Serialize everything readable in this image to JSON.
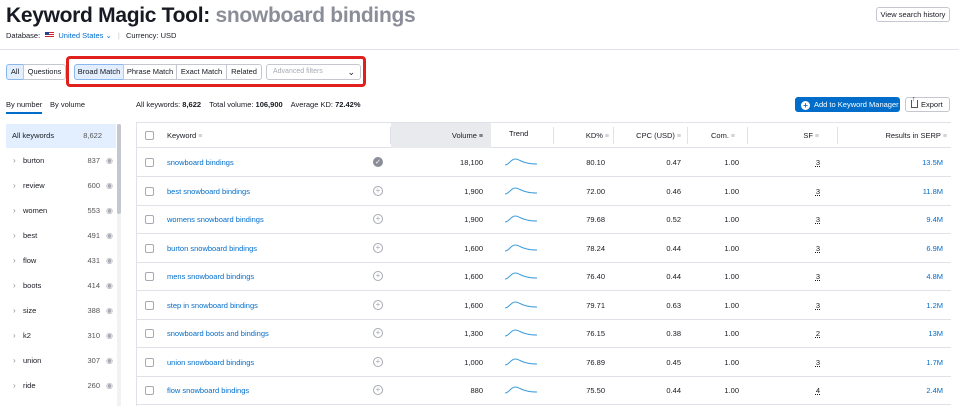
{
  "header": {
    "title_prefix": "Keyword Magic Tool:",
    "title_query": "snowboard bindings",
    "database_label": "Database:",
    "database_value": "United States",
    "currency_label": "Currency:",
    "currency_value": "USD",
    "history_button": "View search history"
  },
  "filters": {
    "all": "All",
    "questions": "Questions",
    "broad_match": "Broad Match",
    "phrase_match": "Phrase Match",
    "exact_match": "Exact Match",
    "related": "Related",
    "advanced_placeholder": "Advanced filters"
  },
  "side_tabs": {
    "by_number": "By number",
    "by_volume": "By volume"
  },
  "summary": {
    "all_keywords_label": "All keywords:",
    "all_keywords_value": "8,622",
    "total_volume_label": "Total volume:",
    "total_volume_value": "106,900",
    "avg_kd_label": "Average KD:",
    "avg_kd_value": "72.42%"
  },
  "actions": {
    "add_to_manager": "Add to Keyword Manager",
    "export": "Export"
  },
  "sidebar": {
    "items": [
      {
        "label": "All keywords",
        "count": "8,622"
      },
      {
        "label": "burton",
        "count": "837"
      },
      {
        "label": "review",
        "count": "600"
      },
      {
        "label": "women",
        "count": "553"
      },
      {
        "label": "best",
        "count": "491"
      },
      {
        "label": "flow",
        "count": "431"
      },
      {
        "label": "boots",
        "count": "414"
      },
      {
        "label": "size",
        "count": "388"
      },
      {
        "label": "k2",
        "count": "310"
      },
      {
        "label": "union",
        "count": "307"
      },
      {
        "label": "ride",
        "count": "260"
      }
    ]
  },
  "table": {
    "columns": {
      "keyword": "Keyword",
      "volume": "Volume",
      "trend": "Trend",
      "kd": "KD%",
      "cpc": "CPC (USD)",
      "com": "Com.",
      "sf": "SF",
      "results": "Results in SERP"
    },
    "rows": [
      {
        "keyword": "snowboard bindings",
        "added": true,
        "volume": "18,100",
        "kd": "80.10",
        "cpc": "0.47",
        "com": "1.00",
        "sf": "3",
        "results": "13.5M"
      },
      {
        "keyword": "best snowboard bindings",
        "added": false,
        "volume": "1,900",
        "kd": "72.00",
        "cpc": "0.46",
        "com": "1.00",
        "sf": "3",
        "results": "11.8M"
      },
      {
        "keyword": "womens snowboard bindings",
        "added": false,
        "volume": "1,900",
        "kd": "79.68",
        "cpc": "0.52",
        "com": "1.00",
        "sf": "3",
        "results": "9.4M"
      },
      {
        "keyword": "burton snowboard bindings",
        "added": false,
        "volume": "1,600",
        "kd": "78.24",
        "cpc": "0.44",
        "com": "1.00",
        "sf": "3",
        "results": "6.9M"
      },
      {
        "keyword": "mens snowboard bindings",
        "added": false,
        "volume": "1,600",
        "kd": "76.40",
        "cpc": "0.44",
        "com": "1.00",
        "sf": "3",
        "results": "4.8M"
      },
      {
        "keyword": "step in snowboard bindings",
        "added": false,
        "volume": "1,600",
        "kd": "79.71",
        "cpc": "0.63",
        "com": "1.00",
        "sf": "3",
        "results": "1.2M"
      },
      {
        "keyword": "snowboard boots and bindings",
        "added": false,
        "volume": "1,300",
        "kd": "76.15",
        "cpc": "0.38",
        "com": "1.00",
        "sf": "2",
        "results": "13M"
      },
      {
        "keyword": "union snowboard bindings",
        "added": false,
        "volume": "1,000",
        "kd": "76.89",
        "cpc": "0.45",
        "com": "1.00",
        "sf": "3",
        "results": "1.7M"
      },
      {
        "keyword": "flow snowboard bindings",
        "added": false,
        "volume": "880",
        "kd": "75.50",
        "cpc": "0.44",
        "com": "1.00",
        "sf": "4",
        "results": "2.4M"
      }
    ]
  },
  "colors": {
    "accent": "#006dca",
    "highlight": "#e0201c",
    "active_bg": "#e3efff"
  }
}
